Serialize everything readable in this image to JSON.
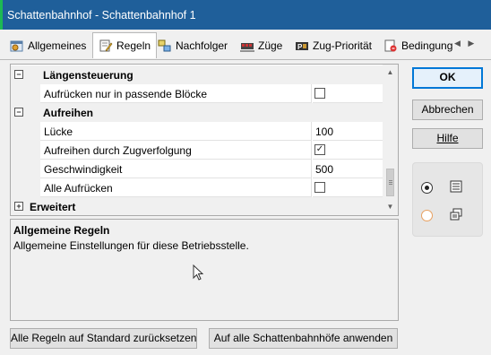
{
  "window": {
    "title": "Schattenbahnhof - Schattenbahnhof 1"
  },
  "tabs": [
    {
      "label": "Allgemeines",
      "icon": "gear-window-icon"
    },
    {
      "label": "Regeln",
      "icon": "rules-edit-icon",
      "active": true
    },
    {
      "label": "Nachfolger",
      "icon": "successor-icon"
    },
    {
      "label": "Züge",
      "icon": "trains-icon"
    },
    {
      "label": "Zug-Priorität",
      "icon": "priority-icon"
    },
    {
      "label": "Bedingung",
      "icon": "condition-icon"
    }
  ],
  "grid": {
    "categories": {
      "laengensteuerung": "Längensteuerung",
      "aufreihen": "Aufreihen",
      "erweitert": "Erweitert"
    },
    "rows": [
      {
        "label": "Aufrücken nur in passende Blöcke",
        "checked": false
      },
      {
        "label": "Lücke",
        "value": "100"
      },
      {
        "label": "Aufreihen durch Zugverfolgung",
        "checked": true
      },
      {
        "label": "Geschwindigkeit",
        "value": "500"
      },
      {
        "label": "Alle Aufrücken",
        "checked": false
      }
    ]
  },
  "description": {
    "title": "Allgemeine Regeln",
    "text": "Allgemeine Einstellungen für diese Betriebsstelle."
  },
  "buttons": {
    "ok": "OK",
    "cancel": "Abbrechen",
    "help": "Hilfe",
    "reset": "Alle Regeln auf Standard zurücksetzen",
    "apply_all": "Auf alle Schattenbahnhöfe anwenden"
  },
  "view_options": {
    "selected": "list-view"
  },
  "colors": {
    "titlebar": "#1f5f9a",
    "ok_border": "#0078d7"
  }
}
